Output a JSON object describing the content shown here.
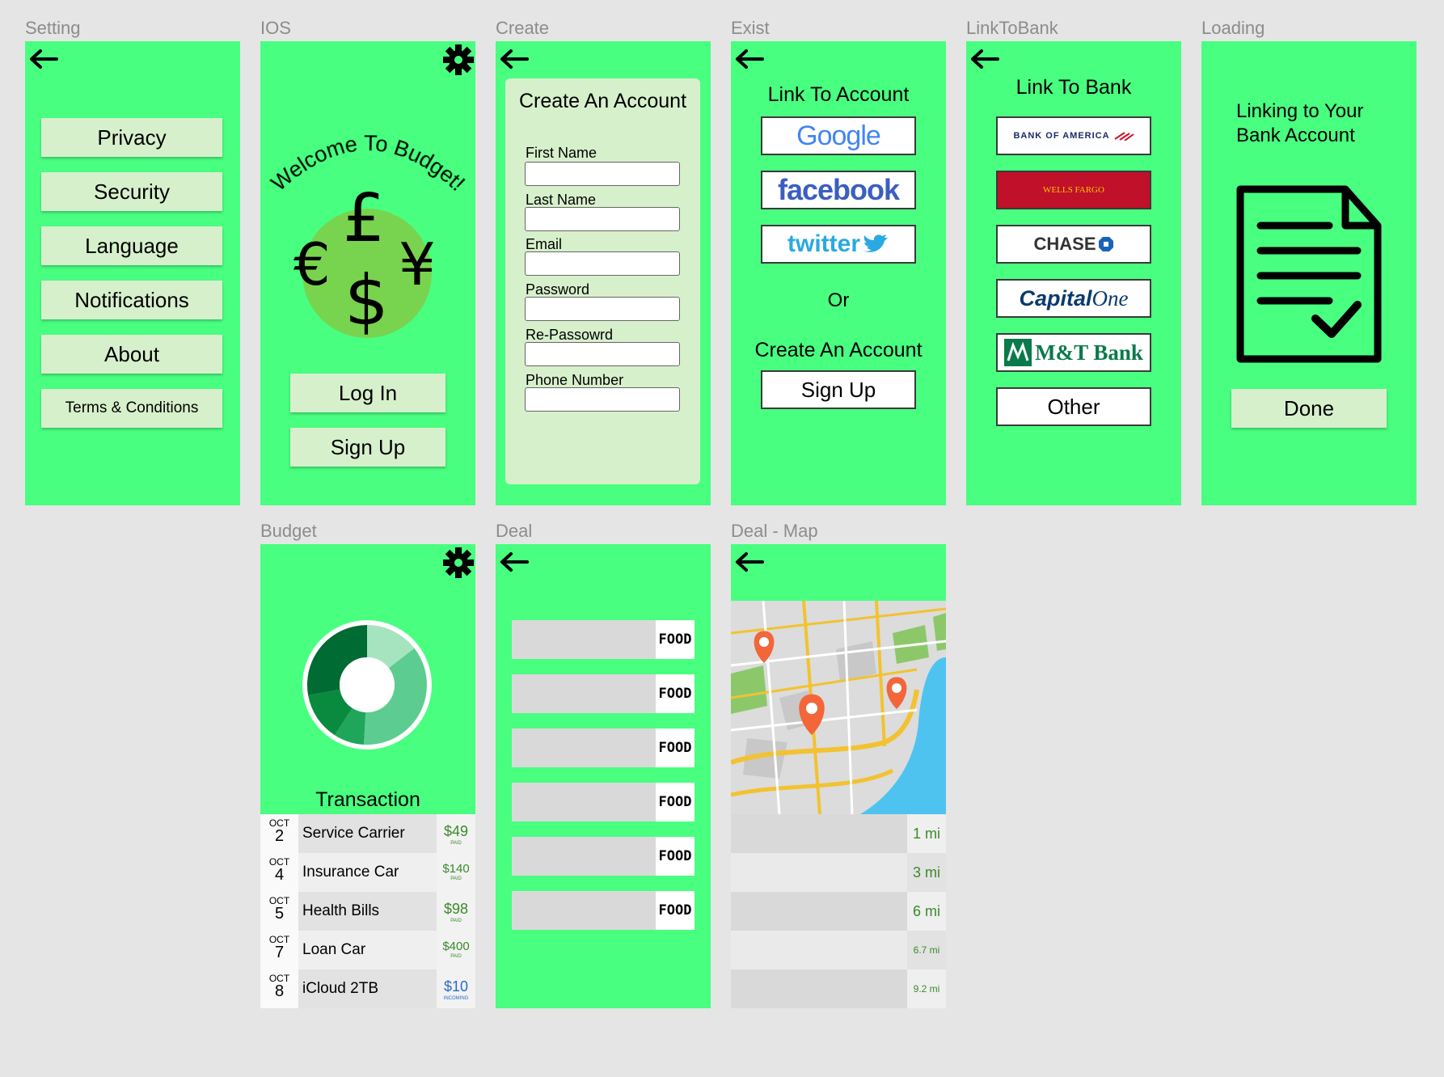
{
  "frames": {
    "setting": {
      "label": "Setting",
      "buttons": [
        "Privacy",
        "Security",
        "Language",
        "Notifications",
        "About",
        "Terms & Conditions"
      ]
    },
    "ios": {
      "label": "IOS",
      "welcome": "Welcome To Budget!",
      "symbols": {
        "pound": "£",
        "euro": "€",
        "yen": "¥",
        "dollar": "$"
      },
      "login": "Log In",
      "signup": "Sign Up"
    },
    "create": {
      "label": "Create",
      "title": "Create An Account",
      "fields": [
        "First Name",
        "Last Name",
        "Email",
        "Password",
        "Re-Passowrd",
        "Phone Number"
      ]
    },
    "exist": {
      "label": "Exist",
      "title": "Link To Account",
      "providers": {
        "google": "Google",
        "facebook": "facebook",
        "twitter": "twitter"
      },
      "or": "Or",
      "create_title": "Create An Account",
      "signup": "Sign Up"
    },
    "linktobank": {
      "label": "LinkToBank",
      "title": "Link To Bank",
      "banks": {
        "boa": "BANK OF AMERICA",
        "wells": "WELLS FARGO",
        "chase": "CHASE",
        "capital_a": "Capital",
        "capital_b": "One",
        "mt": "M&T Bank"
      },
      "other": "Other"
    },
    "loading": {
      "label": "Loading",
      "title": "Linking to Your Bank Account",
      "done": "Done"
    },
    "budget": {
      "label": "Budget",
      "transaction_title": "Transaction",
      "transactions": [
        {
          "month": "OCT",
          "day": "2",
          "name": "Service Carrier",
          "amount": "$49",
          "status": "PAID"
        },
        {
          "month": "OCT",
          "day": "4",
          "name": "Insurance Car",
          "amount": "$140",
          "status": "PAID"
        },
        {
          "month": "OCT",
          "day": "5",
          "name": "Health Bills",
          "amount": "$98",
          "status": "PAID"
        },
        {
          "month": "OCT",
          "day": "7",
          "name": "Loan Car",
          "amount": "$400",
          "status": "PAID"
        },
        {
          "month": "OCT",
          "day": "8",
          "name": "iCloud 2TB",
          "amount": "$10",
          "status": "INCOMING"
        }
      ],
      "colors": {
        "paid": "#3a8a2a",
        "incoming": "#2a6cc8"
      }
    },
    "deal": {
      "label": "Deal",
      "tags": [
        "FOOD",
        "FOOD",
        "FOOD",
        "FOOD",
        "FOOD",
        "FOOD"
      ]
    },
    "dealmap": {
      "label": "Deal - Map",
      "distances": [
        "1 mi",
        "3 mi",
        "6 mi",
        "6.7 mi",
        "9.2 mi"
      ]
    }
  },
  "colors": {
    "frame_bg": "#48ff80",
    "button_bg": "#d7f0cc",
    "canvas_bg": "#e5e5e5"
  },
  "icons": {
    "back": "arrow-left-icon",
    "settings": "gear-icon"
  }
}
